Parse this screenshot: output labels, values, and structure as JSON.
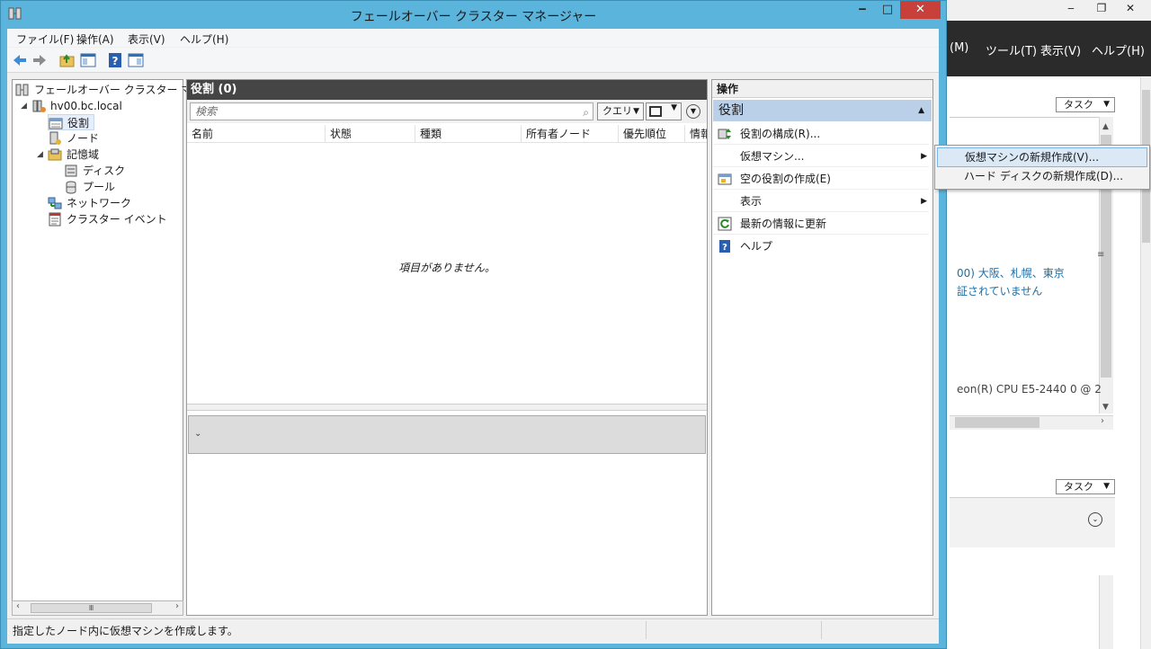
{
  "background_window": {
    "menu": [
      "(M)",
      "ツール(T)",
      "表示(V)",
      "ヘルプ(H)"
    ],
    "task_buttons": [
      "タスク",
      "タスク"
    ],
    "text_lines": [
      "00) 大阪、札幌、東京",
      "証されていません",
      "eon(R) CPU E5-2440 0 @ 2"
    ],
    "colors": {
      "menubar": "#2b2b2b",
      "link": "#1a6fa8"
    }
  },
  "window": {
    "title": "フェールオーバー クラスター マネージャー",
    "controls": {
      "minimize": "‒",
      "maximize": "□",
      "close": "✕"
    }
  },
  "menubar": [
    "ファイル(F)",
    "操作(A)",
    "表示(V)",
    "ヘルプ(H)"
  ],
  "toolbar": [
    "back-icon",
    "forward-icon",
    "up-folder-icon",
    "console-tree-icon",
    "help-icon",
    "action-pane-icon"
  ],
  "tree": {
    "root": "フェールオーバー クラスター マネージャー",
    "cluster": "hv00.bc.local",
    "roles": "役割",
    "nodes": "ノード",
    "storage": "記憶域",
    "disks": "ディスク",
    "pools": "プール",
    "networks": "ネットワーク",
    "events": "クラスター イベント",
    "scroll_thumb": "Ⅲ"
  },
  "center": {
    "header": "役割 (0)",
    "search_placeholder": "検索",
    "query_label": "クエリ",
    "columns": [
      "名前",
      "状態",
      "種類",
      "所有者ノード",
      "優先順位",
      "情報"
    ],
    "empty_message": "項目がありません。"
  },
  "actions": {
    "header": "操作",
    "section": "役割",
    "items": [
      {
        "label": "役割の構成(R)...",
        "icon": "configure-role-icon",
        "submenu": false
      },
      {
        "label": "仮想マシン...",
        "icon": "",
        "submenu": true
      },
      {
        "label": "空の役割の作成(E)",
        "icon": "empty-role-icon",
        "submenu": false
      },
      {
        "label": "表示",
        "icon": "",
        "submenu": true
      },
      {
        "label": "最新の情報に更新",
        "icon": "refresh-icon",
        "submenu": false
      },
      {
        "label": "ヘルプ",
        "icon": "help-icon",
        "submenu": false
      }
    ]
  },
  "submenu": {
    "items": [
      "仮想マシンの新規作成(V)...",
      "ハード ディスクの新規作成(D)..."
    ],
    "highlighted": 0
  },
  "statusbar": {
    "text": "指定したノード内に仮想マシンを作成します。"
  },
  "colors": {
    "window_frame": "#5ab4dc",
    "center_header": "#454545",
    "actions_section": "#b9d0e8",
    "close_button": "#c7403a",
    "submenu_highlight": "#dbe8f6"
  }
}
